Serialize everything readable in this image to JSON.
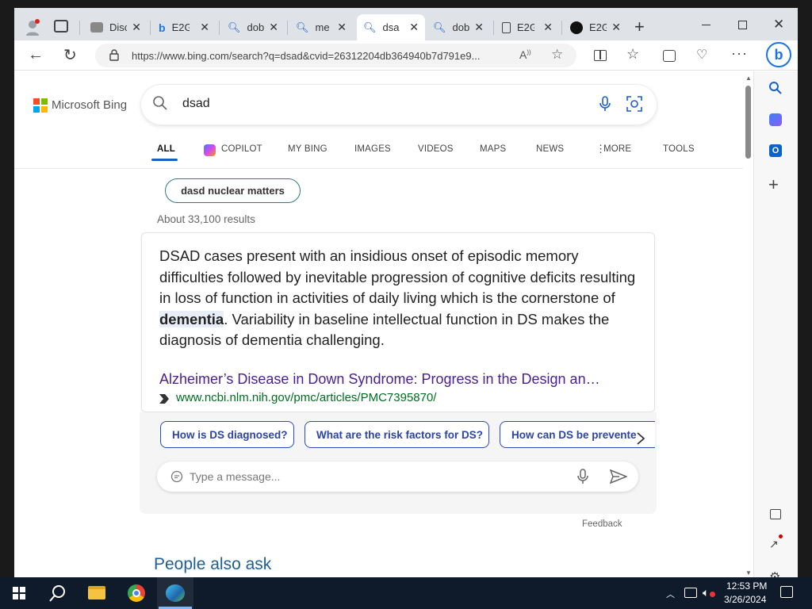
{
  "tabs": [
    {
      "title": "Disc",
      "icon": "discord-icon"
    },
    {
      "title": "E2G",
      "icon": "bing-icon"
    },
    {
      "title": "dob",
      "icon": "search-icon"
    },
    {
      "title": "me",
      "icon": "search-icon"
    },
    {
      "title": "dsa",
      "icon": "search-icon",
      "active": true
    },
    {
      "title": "dob",
      "icon": "search-icon"
    },
    {
      "title": "E2G",
      "icon": "page-icon"
    },
    {
      "title": "E2G",
      "icon": "github-icon"
    }
  ],
  "address": "https://www.bing.com/search?q=dsad&cvid=26312204db364940b7d791e9...",
  "logo": "Microsoft Bing",
  "search": {
    "query": "dsad"
  },
  "nav": [
    "ALL",
    "COPILOT",
    "MY BING",
    "IMAGES",
    "VIDEOS",
    "MAPS",
    "NEWS",
    "MORE",
    "TOOLS"
  ],
  "suggestion": "dasd nuclear matters",
  "result_count": "About 33,100 results",
  "answer": {
    "pre": "DSAD cases present with an insidious onset of episodic memory difficulties followed by inevitable progression of cognitive deficits resulting in loss of function in activities of daily living which is the cornerstone of ",
    "bold": "dementia",
    "post": ". Variability in baseline intellectual function in DS makes the diagnosis of dementia challenging.",
    "link_title": "Alzheimer’s Disease in Down Syndrome: Progress in the Design an…",
    "link_url": "www.ncbi.nlm.nih.gov/pmc/articles/PMC7395870/"
  },
  "followups": [
    "How is DS diagnosed?",
    "What are the risk factors for DS?",
    "How can DS be prevente"
  ],
  "message_placeholder": "Type a message...",
  "feedback": "Feedback",
  "people_also_ask": "People also ask",
  "clock": {
    "time": "12:53 PM",
    "date": "3/26/2024"
  },
  "colors": {
    "accent": "#2a44a8",
    "link": "#4a1f8f",
    "url": "#006d21",
    "edge_blue": "#0078d4"
  }
}
